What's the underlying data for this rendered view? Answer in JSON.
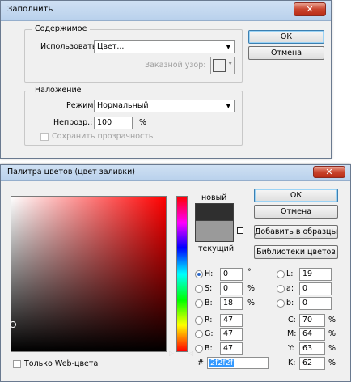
{
  "fill_dialog": {
    "title": "Заполнить",
    "close_glyph": "✕",
    "contents": {
      "legend": "Содержимое",
      "use_label": "Использовать:",
      "use_value": "Цвет...",
      "custom_pattern_label": "Заказной узор:"
    },
    "blending": {
      "legend": "Наложение",
      "mode_label": "Режим:",
      "mode_value": "Нормальный",
      "opacity_label": "Непрозр.:",
      "opacity_value": "100",
      "opacity_unit": "%",
      "preserve_transparency_label": "Сохранить прозрачность",
      "preserve_transparency_checked": false
    },
    "ok_label": "ОК",
    "cancel_label": "Отмена"
  },
  "color_picker": {
    "title": "Палитра цветов (цвет заливки)",
    "close_glyph": "✕",
    "new_label": "новый",
    "current_label": "текущий",
    "new_color": "#2f2f2f",
    "current_color": "#9a9a9a",
    "ok_label": "ОК",
    "cancel_label": "Отмена",
    "add_to_swatches_label": "Добавить в образцы",
    "color_libraries_label": "Библиотеки цветов",
    "web_only_label": "Только Web-цвета",
    "web_only_checked": false,
    "fields": {
      "H": {
        "label": "H:",
        "value": "0",
        "unit": "°"
      },
      "S": {
        "label": "S:",
        "value": "0",
        "unit": "%"
      },
      "B": {
        "label": "B:",
        "value": "18",
        "unit": "%"
      },
      "R": {
        "label": "R:",
        "value": "47",
        "unit": ""
      },
      "G": {
        "label": "G:",
        "value": "47",
        "unit": ""
      },
      "Bb": {
        "label": "B:",
        "value": "47",
        "unit": ""
      },
      "L": {
        "label": "L:",
        "value": "19",
        "unit": ""
      },
      "a": {
        "label": "a:",
        "value": "0",
        "unit": ""
      },
      "b": {
        "label": "b:",
        "value": "0",
        "unit": ""
      },
      "C": {
        "label": "C:",
        "value": "70",
        "unit": "%"
      },
      "M": {
        "label": "M:",
        "value": "64",
        "unit": "%"
      },
      "Y": {
        "label": "Y:",
        "value": "63",
        "unit": "%"
      },
      "K": {
        "label": "K:",
        "value": "62",
        "unit": "%"
      }
    },
    "hex_prefix": "#",
    "hex_value": "2f2f2f",
    "selected_mode": "H"
  }
}
